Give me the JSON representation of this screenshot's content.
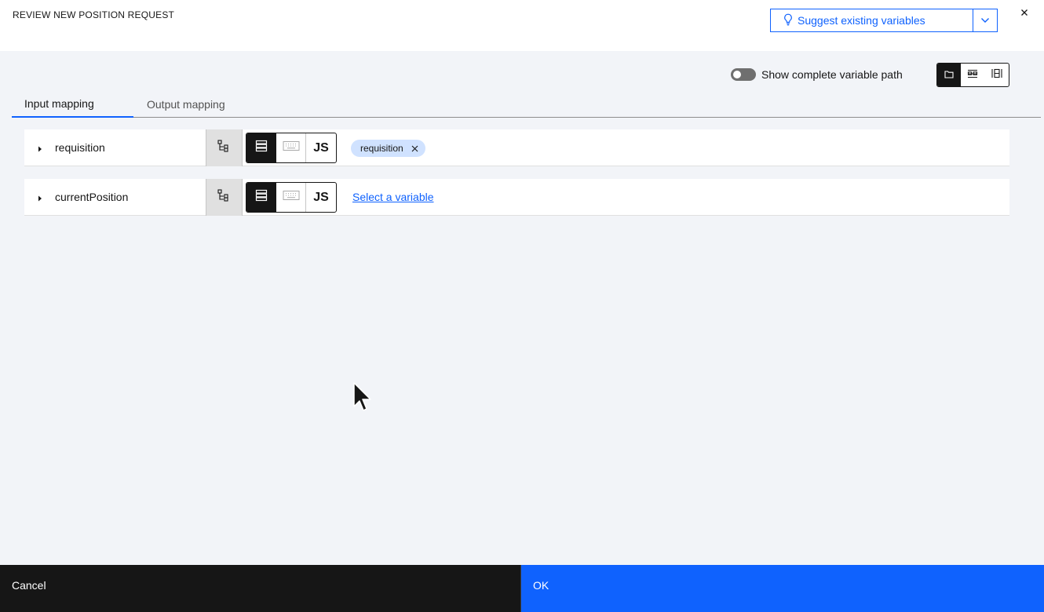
{
  "header": {
    "title": "REVIEW NEW POSITION REQUEST",
    "suggest_label": "Suggest existing variables",
    "icons": {
      "suggest": "lightbulb-icon",
      "dropdown": "chevron-down-icon",
      "close": "close-icon"
    }
  },
  "toolbar": {
    "toggle_label": "Show complete variable path",
    "toggle_on": false,
    "view_modes": [
      "folder-view-icon",
      "list-view-icon",
      "column-view-icon"
    ]
  },
  "tabs": [
    {
      "label": "Input mapping",
      "active": true
    },
    {
      "label": "Output mapping",
      "active": false
    }
  ],
  "rows": [
    {
      "name": "requisition",
      "mapped_tag": "requisition",
      "js_label": "JS"
    },
    {
      "name": "currentPosition",
      "link_text": "Select a variable",
      "js_label": "JS"
    }
  ],
  "footer": {
    "cancel_label": "Cancel",
    "ok_label": "OK"
  },
  "colors": {
    "accent": "#0f62fe",
    "dark": "#161616",
    "tag_bg": "#d0e2ff",
    "page_bg": "#f2f4f8"
  }
}
